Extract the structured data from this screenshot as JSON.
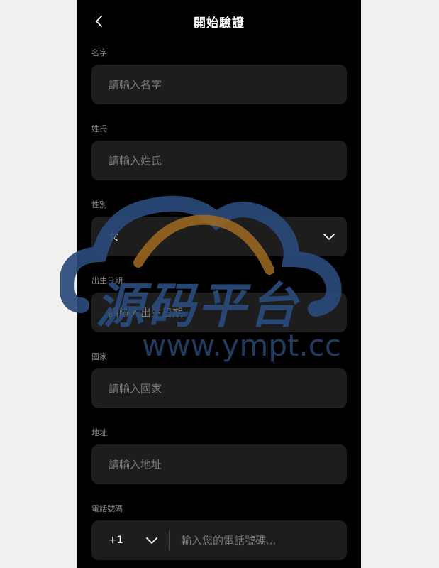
{
  "header": {
    "title": "開始驗證",
    "back_icon": "chevron-left-icon"
  },
  "form": {
    "first_name": {
      "label": "名字",
      "placeholder": "請輸入名字"
    },
    "last_name": {
      "label": "姓氏",
      "placeholder": "請輸入姓氏"
    },
    "gender": {
      "label": "性別",
      "value": "女",
      "icon": "chevron-down-icon"
    },
    "birthdate": {
      "label": "出生日期",
      "placeholder": "請輸入出生日期"
    },
    "country": {
      "label": "國家",
      "placeholder": "請輸入國家"
    },
    "address": {
      "label": "地址",
      "placeholder": "請輸入地址"
    },
    "phone": {
      "label": "電話號碼",
      "country_code": "+1",
      "placeholder": "輸入您的電話號碼...",
      "icon": "chevron-down-icon"
    }
  },
  "watermark": {
    "brand": "源码平台",
    "url": "www.ympt.cc"
  },
  "colors": {
    "background": "#000000",
    "field": "#1d1d1d",
    "label": "#8a8a8a",
    "placeholder": "#7c7c7c",
    "text": "#ffffff",
    "watermark_blue": "#2a4a7a",
    "watermark_gold": "#a06a20"
  }
}
